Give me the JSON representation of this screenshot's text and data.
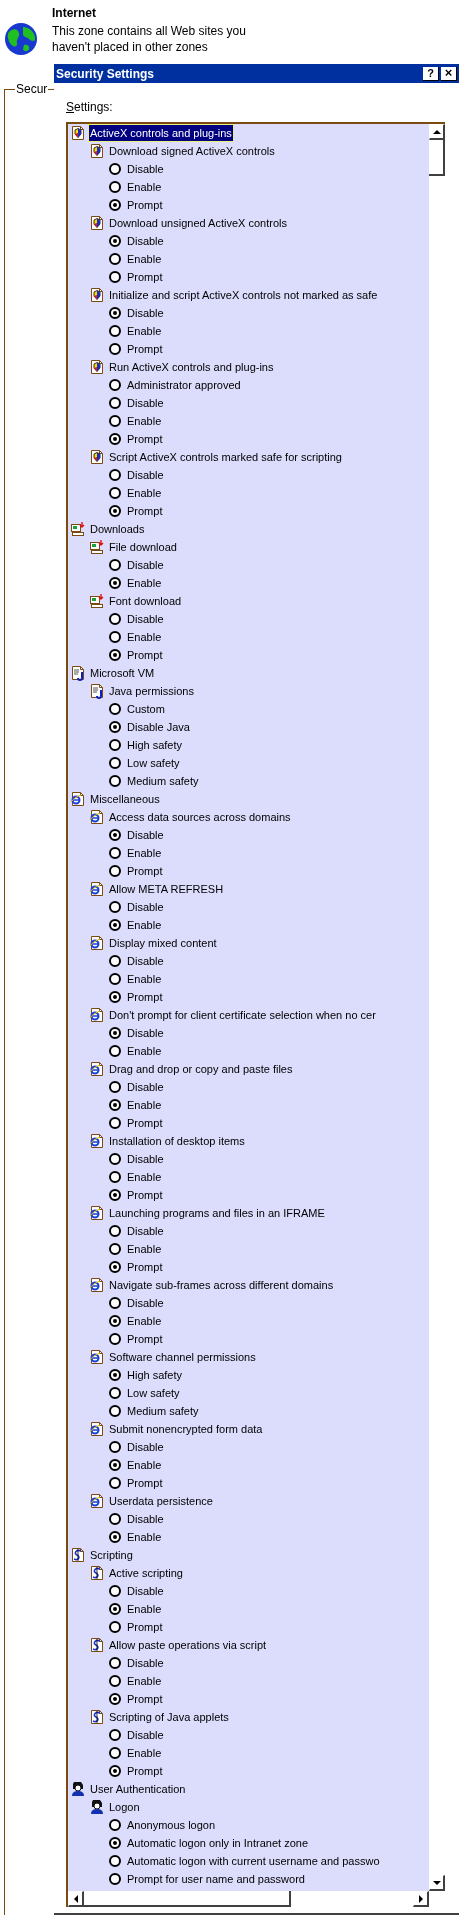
{
  "zone": {
    "name": "Internet",
    "description": "This zone contains all Web sites you haven't placed in other zones"
  },
  "group_label": "Secur",
  "dialog": {
    "title": "Security Settings",
    "help_button": "?",
    "close_button": "×",
    "settings_label": "Settings:"
  },
  "tree": [
    {
      "kind": "category",
      "label": "ActiveX controls and plug-ins",
      "selected": true,
      "children": [
        {
          "kind": "setting",
          "label": "Download signed ActiveX controls",
          "selected": false,
          "children": [
            {
              "kind": "option",
              "label": "Disable",
              "checked": false
            },
            {
              "kind": "option",
              "label": "Enable",
              "checked": false
            },
            {
              "kind": "option",
              "label": "Prompt",
              "checked": true
            }
          ]
        },
        {
          "kind": "setting",
          "label": "Download unsigned ActiveX controls",
          "selected": false,
          "children": [
            {
              "kind": "option",
              "label": "Disable",
              "checked": true
            },
            {
              "kind": "option",
              "label": "Enable",
              "checked": false
            },
            {
              "kind": "option",
              "label": "Prompt",
              "checked": false
            }
          ]
        },
        {
          "kind": "setting",
          "label": "Initialize and script ActiveX controls not marked as safe",
          "selected": false,
          "children": [
            {
              "kind": "option",
              "label": "Disable",
              "checked": true
            },
            {
              "kind": "option",
              "label": "Enable",
              "checked": false
            },
            {
              "kind": "option",
              "label": "Prompt",
              "checked": false
            }
          ]
        },
        {
          "kind": "setting",
          "label": "Run ActiveX controls and plug-ins",
          "selected": false,
          "children": [
            {
              "kind": "option",
              "label": "Administrator approved",
              "checked": false
            },
            {
              "kind": "option",
              "label": "Disable",
              "checked": false
            },
            {
              "kind": "option",
              "label": "Enable",
              "checked": false
            },
            {
              "kind": "option",
              "label": "Prompt",
              "checked": true
            }
          ]
        },
        {
          "kind": "setting",
          "label": "Script ActiveX controls marked safe for scripting",
          "selected": false,
          "children": [
            {
              "kind": "option",
              "label": "Disable",
              "checked": false
            },
            {
              "kind": "option",
              "label": "Enable",
              "checked": false
            },
            {
              "kind": "option",
              "label": "Prompt",
              "checked": true
            }
          ]
        }
      ]
    },
    {
      "kind": "category",
      "label": "Downloads",
      "selected": false,
      "children": [
        {
          "kind": "setting",
          "label": "File download",
          "selected": false,
          "children": [
            {
              "kind": "option",
              "label": "Disable",
              "checked": false
            },
            {
              "kind": "option",
              "label": "Enable",
              "checked": true
            }
          ]
        },
        {
          "kind": "setting",
          "label": "Font download",
          "selected": false,
          "children": [
            {
              "kind": "option",
              "label": "Disable",
              "checked": false
            },
            {
              "kind": "option",
              "label": "Enable",
              "checked": false
            },
            {
              "kind": "option",
              "label": "Prompt",
              "checked": true
            }
          ]
        }
      ]
    },
    {
      "kind": "category",
      "label": "Microsoft VM",
      "selected": false,
      "children": [
        {
          "kind": "setting",
          "label": "Java permissions",
          "selected": false,
          "children": [
            {
              "kind": "option",
              "label": "Custom",
              "checked": false
            },
            {
              "kind": "option",
              "label": "Disable Java",
              "checked": true
            },
            {
              "kind": "option",
              "label": "High safety",
              "checked": false
            },
            {
              "kind": "option",
              "label": "Low safety",
              "checked": false
            },
            {
              "kind": "option",
              "label": "Medium safety",
              "checked": false
            }
          ]
        }
      ]
    },
    {
      "kind": "category",
      "label": "Miscellaneous",
      "selected": false,
      "children": [
        {
          "kind": "setting",
          "label": "Access data sources across domains",
          "selected": false,
          "children": [
            {
              "kind": "option",
              "label": "Disable",
              "checked": true
            },
            {
              "kind": "option",
              "label": "Enable",
              "checked": false
            },
            {
              "kind": "option",
              "label": "Prompt",
              "checked": false
            }
          ]
        },
        {
          "kind": "setting",
          "label": "Allow META REFRESH",
          "selected": false,
          "children": [
            {
              "kind": "option",
              "label": "Disable",
              "checked": false
            },
            {
              "kind": "option",
              "label": "Enable",
              "checked": true
            }
          ]
        },
        {
          "kind": "setting",
          "label": "Display mixed content",
          "selected": false,
          "children": [
            {
              "kind": "option",
              "label": "Disable",
              "checked": false
            },
            {
              "kind": "option",
              "label": "Enable",
              "checked": false
            },
            {
              "kind": "option",
              "label": "Prompt",
              "checked": true
            }
          ]
        },
        {
          "kind": "setting",
          "label": "Don't prompt for client certificate selection when no cer",
          "selected": false,
          "children": [
            {
              "kind": "option",
              "label": "Disable",
              "checked": true
            },
            {
              "kind": "option",
              "label": "Enable",
              "checked": false
            }
          ]
        },
        {
          "kind": "setting",
          "label": "Drag and drop or copy and paste files",
          "selected": false,
          "children": [
            {
              "kind": "option",
              "label": "Disable",
              "checked": false
            },
            {
              "kind": "option",
              "label": "Enable",
              "checked": true
            },
            {
              "kind": "option",
              "label": "Prompt",
              "checked": false
            }
          ]
        },
        {
          "kind": "setting",
          "label": "Installation of desktop items",
          "selected": false,
          "children": [
            {
              "kind": "option",
              "label": "Disable",
              "checked": false
            },
            {
              "kind": "option",
              "label": "Enable",
              "checked": false
            },
            {
              "kind": "option",
              "label": "Prompt",
              "checked": true
            }
          ]
        },
        {
          "kind": "setting",
          "label": "Launching programs and files in an IFRAME",
          "selected": false,
          "children": [
            {
              "kind": "option",
              "label": "Disable",
              "checked": false
            },
            {
              "kind": "option",
              "label": "Enable",
              "checked": false
            },
            {
              "kind": "option",
              "label": "Prompt",
              "checked": true
            }
          ]
        },
        {
          "kind": "setting",
          "label": "Navigate sub-frames across different domains",
          "selected": false,
          "children": [
            {
              "kind": "option",
              "label": "Disable",
              "checked": false
            },
            {
              "kind": "option",
              "label": "Enable",
              "checked": true
            },
            {
              "kind": "option",
              "label": "Prompt",
              "checked": false
            }
          ]
        },
        {
          "kind": "setting",
          "label": "Software channel permissions",
          "selected": false,
          "children": [
            {
              "kind": "option",
              "label": "High safety",
              "checked": true
            },
            {
              "kind": "option",
              "label": "Low safety",
              "checked": false
            },
            {
              "kind": "option",
              "label": "Medium safety",
              "checked": false
            }
          ]
        },
        {
          "kind": "setting",
          "label": "Submit nonencrypted form data",
          "selected": false,
          "children": [
            {
              "kind": "option",
              "label": "Disable",
              "checked": false
            },
            {
              "kind": "option",
              "label": "Enable",
              "checked": true
            },
            {
              "kind": "option",
              "label": "Prompt",
              "checked": false
            }
          ]
        },
        {
          "kind": "setting",
          "label": "Userdata persistence",
          "selected": false,
          "children": [
            {
              "kind": "option",
              "label": "Disable",
              "checked": false
            },
            {
              "kind": "option",
              "label": "Enable",
              "checked": true
            }
          ]
        }
      ]
    },
    {
      "kind": "category",
      "label": "Scripting",
      "selected": false,
      "children": [
        {
          "kind": "setting",
          "label": "Active scripting",
          "selected": false,
          "children": [
            {
              "kind": "option",
              "label": "Disable",
              "checked": false
            },
            {
              "kind": "option",
              "label": "Enable",
              "checked": true
            },
            {
              "kind": "option",
              "label": "Prompt",
              "checked": false
            }
          ]
        },
        {
          "kind": "setting",
          "label": "Allow paste operations via script",
          "selected": false,
          "children": [
            {
              "kind": "option",
              "label": "Disable",
              "checked": false
            },
            {
              "kind": "option",
              "label": "Enable",
              "checked": false
            },
            {
              "kind": "option",
              "label": "Prompt",
              "checked": true
            }
          ]
        },
        {
          "kind": "setting",
          "label": "Scripting of Java applets",
          "selected": false,
          "children": [
            {
              "kind": "option",
              "label": "Disable",
              "checked": false
            },
            {
              "kind": "option",
              "label": "Enable",
              "checked": false
            },
            {
              "kind": "option",
              "label": "Prompt",
              "checked": true
            }
          ]
        }
      ]
    },
    {
      "kind": "category",
      "label": "User Authentication",
      "selected": false,
      "children": [
        {
          "kind": "setting",
          "label": "Logon",
          "selected": false,
          "children": [
            {
              "kind": "option",
              "label": "Anonymous logon",
              "checked": false
            },
            {
              "kind": "option",
              "label": "Automatic logon only in Intranet zone",
              "checked": true
            },
            {
              "kind": "option",
              "label": "Automatic logon with current username and passwo",
              "checked": false
            },
            {
              "kind": "option",
              "label": "Prompt for user name and password",
              "checked": false
            }
          ]
        }
      ]
    }
  ]
}
